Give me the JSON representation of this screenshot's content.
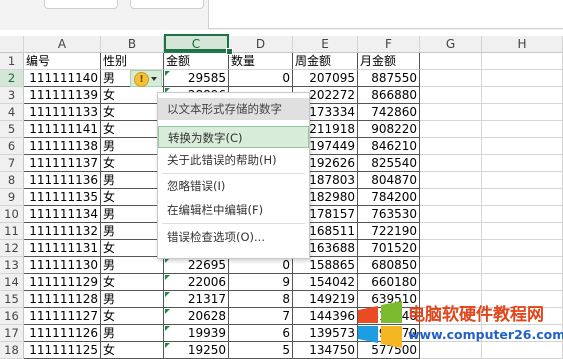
{
  "columns": [
    "A",
    "B",
    "C",
    "D",
    "E",
    "F",
    "G",
    "H"
  ],
  "headers": [
    "编号",
    "性别",
    "金额",
    "数量",
    "周金额",
    "月金额"
  ],
  "rows": [
    {
      "num": "2",
      "id": "111111140",
      "sex": "男",
      "amount": "29585",
      "qty": "0",
      "week": "207095",
      "month": "887550"
    },
    {
      "num": "3",
      "id": "111111139",
      "sex": "女",
      "amount": "28896",
      "qty": "",
      "week": "202272",
      "month": "866880"
    },
    {
      "num": "4",
      "id": "111111133",
      "sex": "女",
      "amount": "",
      "qty": "",
      "week": "173334",
      "month": "742860"
    },
    {
      "num": "5",
      "id": "111111141",
      "sex": "女",
      "amount": "",
      "qty": "",
      "week": "211918",
      "month": "908220"
    },
    {
      "num": "6",
      "id": "111111138",
      "sex": "男",
      "amount": "",
      "qty": "",
      "week": "197449",
      "month": "846210"
    },
    {
      "num": "7",
      "id": "111111137",
      "sex": "女",
      "amount": "",
      "qty": "",
      "week": "192626",
      "month": "825540"
    },
    {
      "num": "8",
      "id": "111111136",
      "sex": "男",
      "amount": "",
      "qty": "",
      "week": "187803",
      "month": "804870"
    },
    {
      "num": "9",
      "id": "111111135",
      "sex": "女",
      "amount": "",
      "qty": "",
      "week": "182980",
      "month": "784200"
    },
    {
      "num": "10",
      "id": "111111134",
      "sex": "男",
      "amount": "",
      "qty": "",
      "week": "178157",
      "month": "763530"
    },
    {
      "num": "11",
      "id": "111111132",
      "sex": "男",
      "amount": "",
      "qty": "",
      "week": "168511",
      "month": "722190"
    },
    {
      "num": "12",
      "id": "111111131",
      "sex": "女",
      "amount": "23384",
      "qty": "",
      "week": "163688",
      "month": "701520"
    },
    {
      "num": "13",
      "id": "111111130",
      "sex": "男",
      "amount": "22695",
      "qty": "0",
      "week": "158865",
      "month": "680850"
    },
    {
      "num": "14",
      "id": "111111129",
      "sex": "女",
      "amount": "22006",
      "qty": "9",
      "week": "154042",
      "month": "660180"
    },
    {
      "num": "15",
      "id": "111111128",
      "sex": "男",
      "amount": "21317",
      "qty": "8",
      "week": "149219",
      "month": "639510"
    },
    {
      "num": "16",
      "id": "111111127",
      "sex": "女",
      "amount": "20628",
      "qty": "7",
      "week": "144396",
      "month": "618840"
    },
    {
      "num": "17",
      "id": "111111126",
      "sex": "男",
      "amount": "19939",
      "qty": "6",
      "week": "139573",
      "month": "598170"
    },
    {
      "num": "18",
      "id": "111111125",
      "sex": "女",
      "amount": "19250",
      "qty": "5",
      "week": "134750",
      "month": "577500"
    }
  ],
  "context_menu": {
    "header": "以文本形式存储的数字",
    "items": [
      {
        "label": "转换为数字(C)"
      },
      {
        "label": "关于此错误的帮助(H)"
      },
      {
        "label": "忽略错误(I)"
      },
      {
        "label": "在编辑栏中编辑(F)"
      },
      {
        "label": "错误检查选项(O)..."
      }
    ]
  },
  "error_icon_symbol": "!",
  "watermark": {
    "title": "电脑软硬件教程网",
    "url": "www.computer26.com"
  },
  "colors": {
    "accent_green": "#1e7145",
    "error_yellow": "#f2c33a",
    "watermark_red": "#e0451b",
    "watermark_blue": "#2361c9"
  }
}
